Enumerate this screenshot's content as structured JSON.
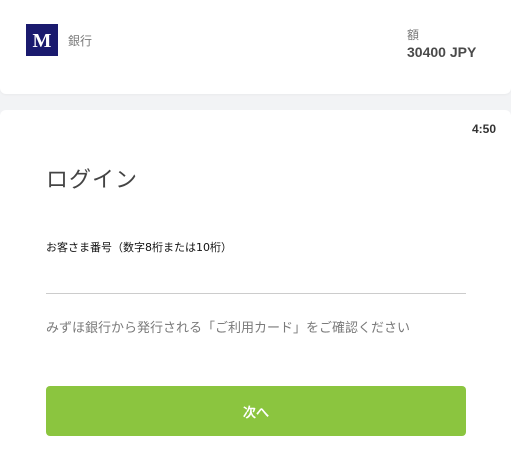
{
  "header": {
    "logo_letter": "M",
    "bank_name": "銀行",
    "amount_label": "額",
    "amount_value": "30400 JPY"
  },
  "login": {
    "timer": "4:50",
    "title": "ログイン",
    "field_label": "お客さま番号（数字8桁または10桁）",
    "field_value": "",
    "helper_text": "みずほ銀行から発行される「ご利用カード」をご確認ください",
    "next_button_label": "次へ"
  },
  "colors": {
    "brand_navy": "#1a1a6e",
    "button_green": "#8bc53f"
  }
}
